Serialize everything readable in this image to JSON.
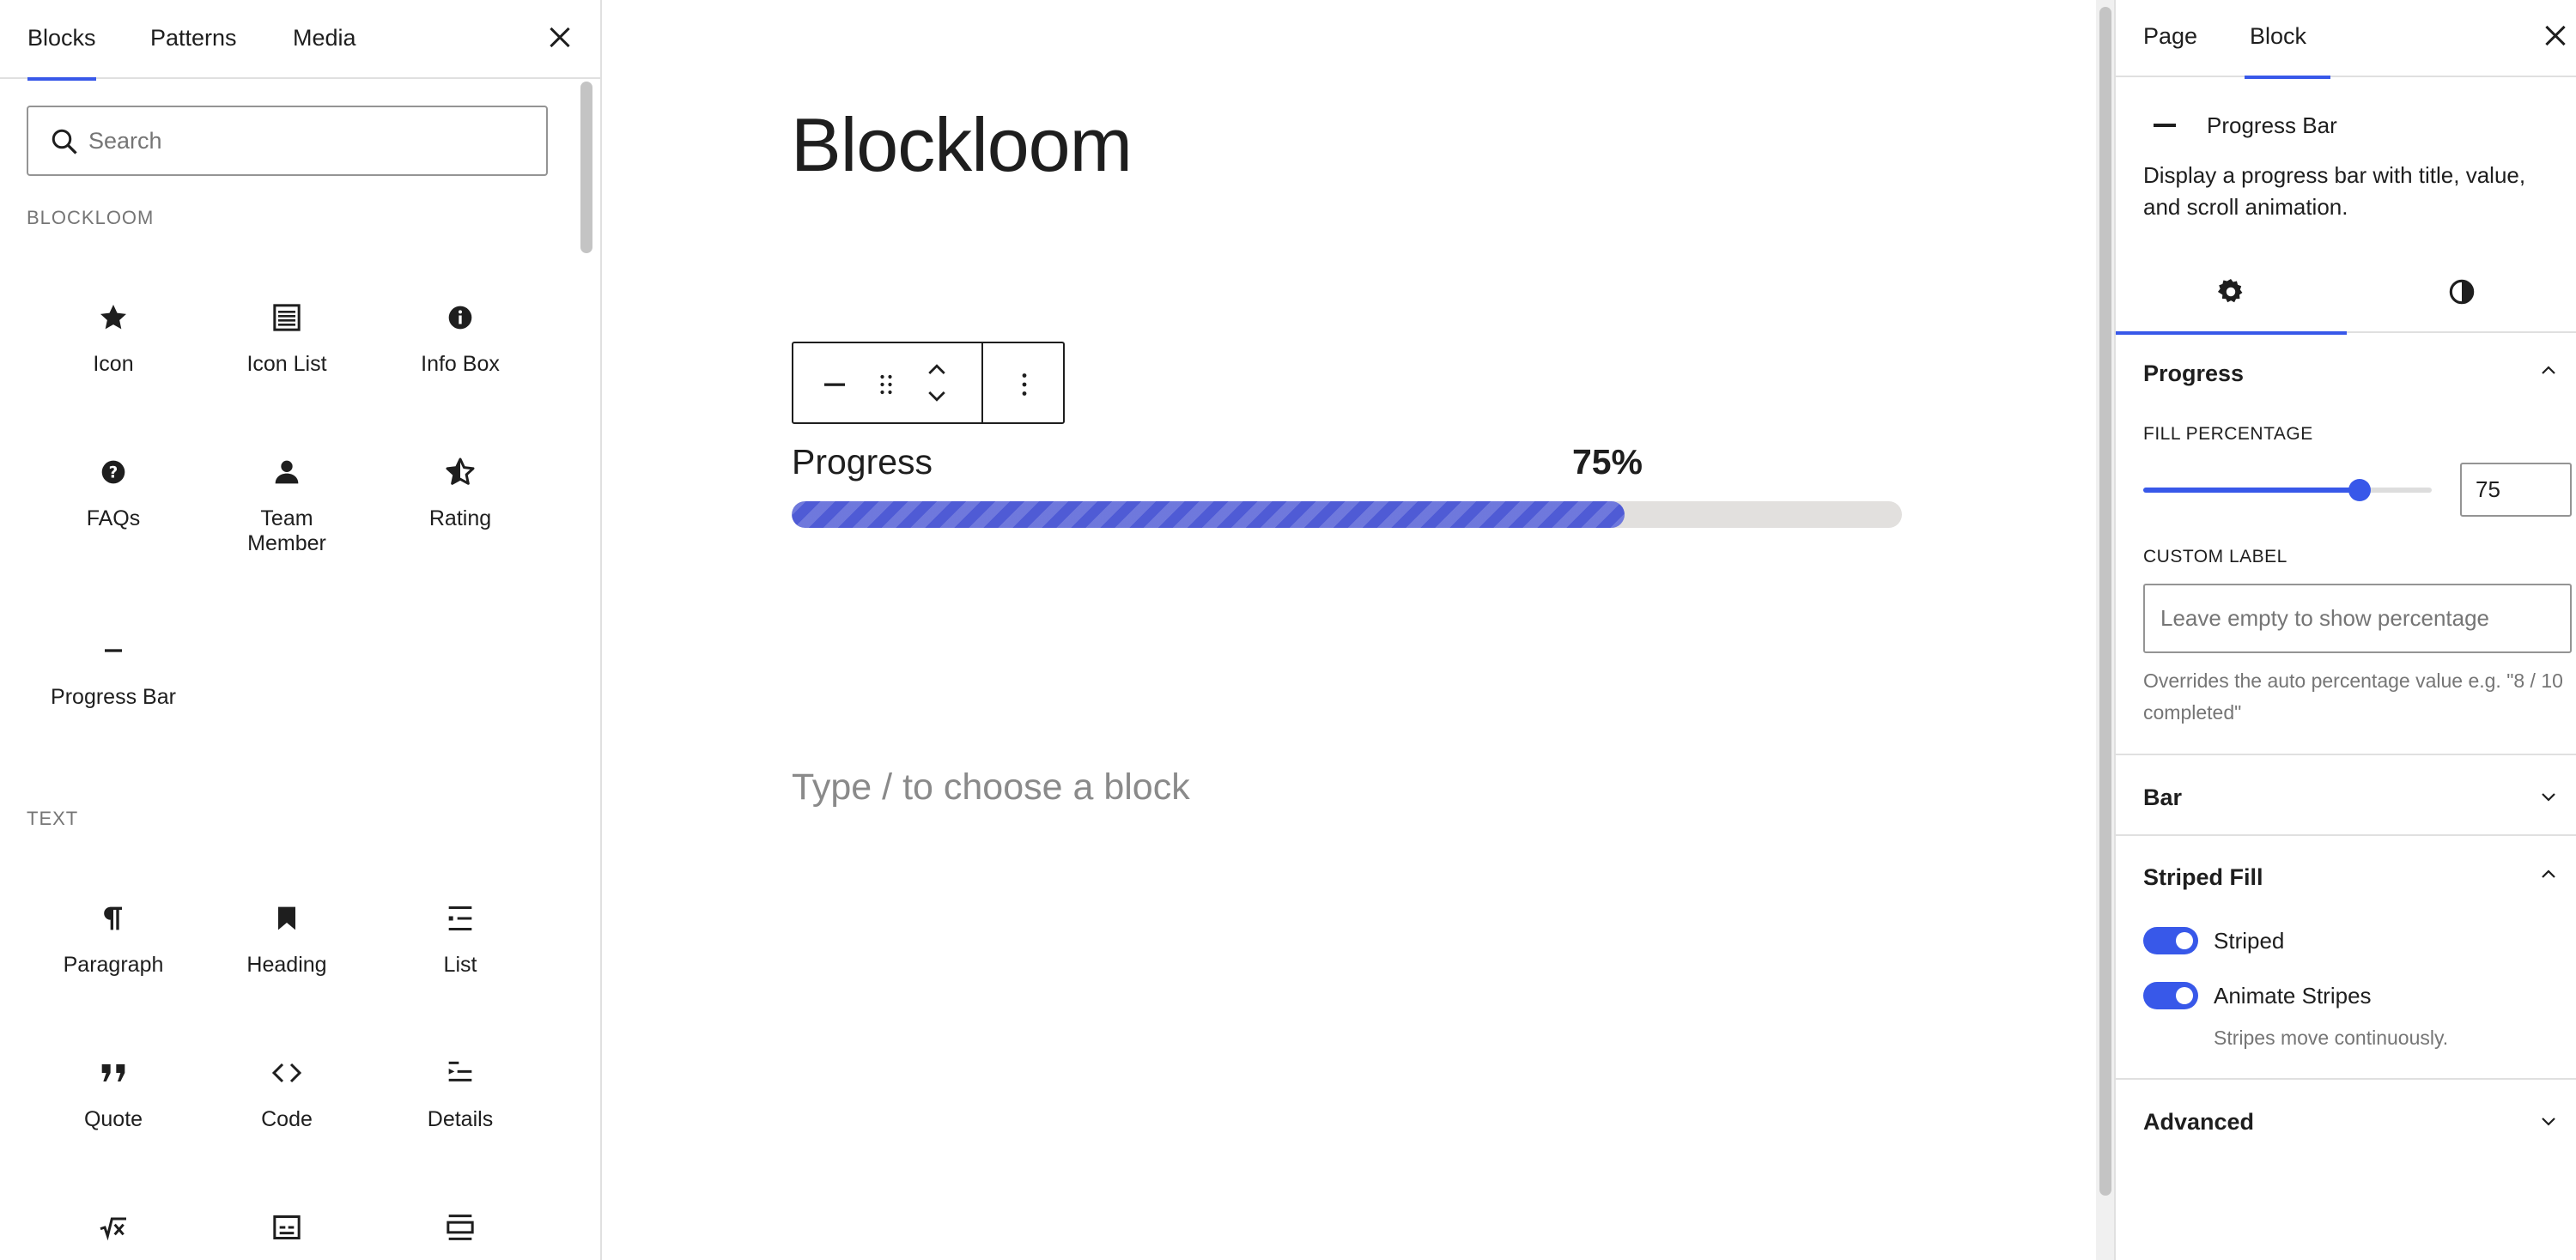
{
  "inserter": {
    "tabs": [
      "Blocks",
      "Patterns",
      "Media"
    ],
    "search_placeholder": "Search",
    "categories": [
      {
        "name": "BLOCKLOOM",
        "blocks": [
          "Icon",
          "Icon List",
          "Info Box",
          "FAQs",
          "Team Member",
          "Rating",
          "Progress Bar"
        ]
      },
      {
        "name": "TEXT",
        "blocks": [
          "Paragraph",
          "Heading",
          "List",
          "Quote",
          "Code",
          "Details"
        ]
      }
    ],
    "icons": [
      "star-icon",
      "list-icon",
      "info-icon",
      "help-icon",
      "person-icon",
      "rating-star-icon",
      "minus-icon",
      "paragraph-icon",
      "bookmark-icon",
      "list-bullets-icon",
      "quote-icon",
      "code-icon",
      "details-icon",
      "math-icon",
      "preformatted-icon",
      "pullquote-icon"
    ]
  },
  "canvas": {
    "title": "Blockloom",
    "progress_block": {
      "title": "Progress",
      "value_label": "75%",
      "fill_fraction": 0.75
    },
    "placeholder": "Type / to choose a block"
  },
  "settings": {
    "tabs": [
      "Page",
      "Block"
    ],
    "block_card": {
      "title": "Progress Bar",
      "description": "Display a progress bar with title, value, and scroll animation."
    },
    "panels": {
      "progress": {
        "title": "Progress",
        "fill_label": "FILL PERCENTAGE",
        "fill_value": "75",
        "custom_label_label": "CUSTOM LABEL",
        "custom_label_placeholder": "Leave empty to show percentage",
        "custom_label_help": "Overrides the auto percentage value e.g. \"8 / 10 completed\""
      },
      "bar": {
        "title": "Bar"
      },
      "striped_fill": {
        "title": "Striped Fill",
        "striped_label": "Striped",
        "striped_on": true,
        "animate_label": "Animate Stripes",
        "animate_on": true,
        "animate_help": "Stripes move continuously."
      },
      "advanced": {
        "title": "Advanced"
      }
    }
  },
  "colors": {
    "accent": "#3858e9",
    "progress_fill": "#4f5bd5",
    "progress_track": "#e2e0de"
  }
}
